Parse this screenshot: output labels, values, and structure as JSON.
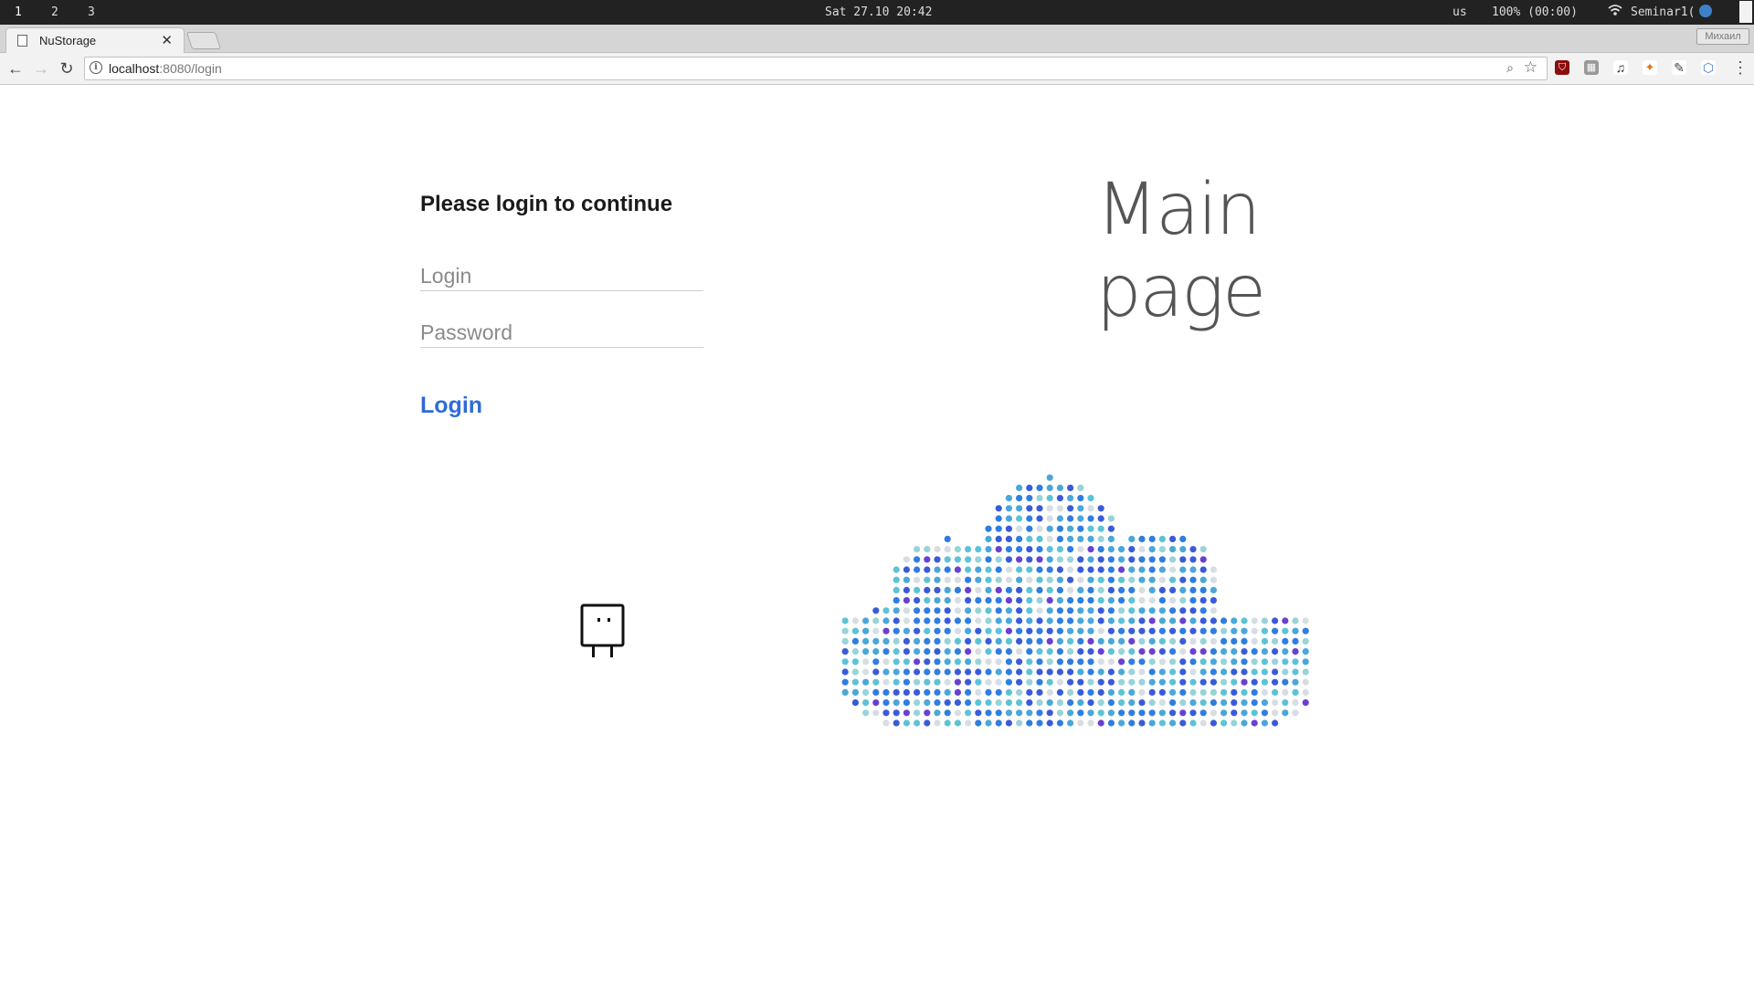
{
  "os": {
    "workspaces": [
      "1",
      "2",
      "3"
    ],
    "datetime": "Sat 27.10 20:42",
    "keyboard": "us",
    "battery": "100% (00:00)",
    "network": "Seminar1("
  },
  "browser": {
    "tab_title": "NuStorage",
    "profile": "Михаил",
    "url_host": "localhost",
    "url_rest": ":8080/login"
  },
  "page": {
    "heading": "Please login to continue",
    "login_placeholder": "Login",
    "password_placeholder": "Password",
    "login_button": "Login",
    "main_title": "Main page"
  },
  "colors": {
    "accent": "#2e6bd9",
    "cloud_palette": [
      "#3a5bd9",
      "#2f7de1",
      "#4aa7d8",
      "#5cc3d5",
      "#98d3d8",
      "#d8dde2",
      "#6a3fd1"
    ]
  },
  "icons": {
    "mascot": "box-character-icon",
    "cloud": "dotted-cloud-illustration"
  }
}
